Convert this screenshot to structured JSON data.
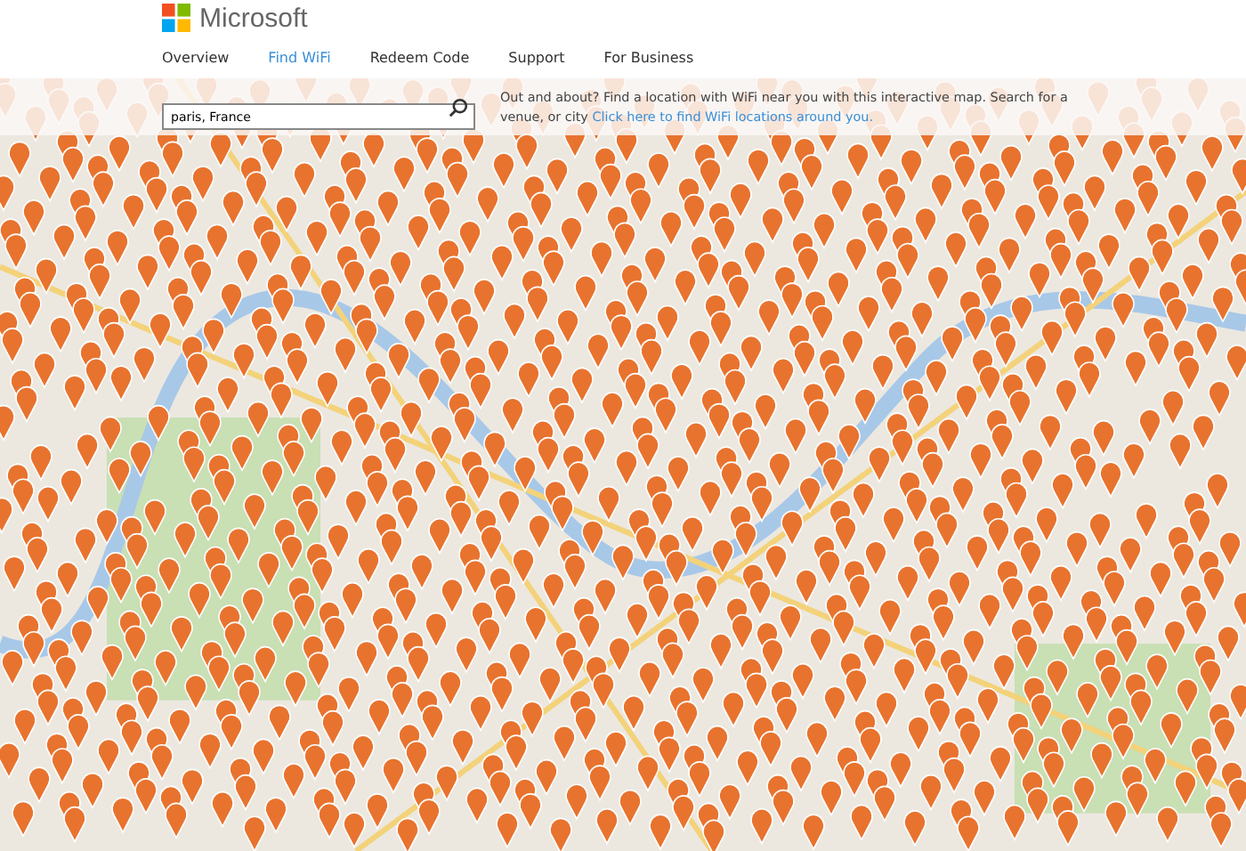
{
  "brand": {
    "name": "Microsoft"
  },
  "nav": [
    {
      "label": "Overview",
      "selected": false
    },
    {
      "label": "Find WiFi",
      "selected": true
    },
    {
      "label": "Redeem Code",
      "selected": false
    },
    {
      "label": "Support",
      "selected": false
    },
    {
      "label": "For Business",
      "selected": false
    }
  ],
  "search": {
    "value": "paris, France"
  },
  "intro": {
    "text": "Out and about? Find a location with WiFi near you with this interactive map. Search for a venue, or city",
    "link": "Click here to find WiFi locations around you."
  }
}
